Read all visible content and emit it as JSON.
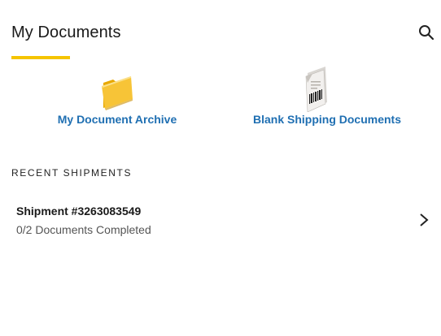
{
  "header": {
    "title": "My Documents",
    "search_icon": "search-icon",
    "accent_color": "#f5c400"
  },
  "tiles": [
    {
      "label": "My Document Archive",
      "icon": "folder-icon"
    },
    {
      "label": "Blank Shipping Documents",
      "icon": "barcode-document-icon"
    }
  ],
  "recent": {
    "section_label": "RECENT SHIPMENTS",
    "items": [
      {
        "title": "Shipment #3263083549",
        "status": "0/2 Documents Completed",
        "icon": "chevron-right-icon"
      }
    ]
  },
  "colors": {
    "link": "#1f6fb2",
    "text": "#1a1a1a",
    "muted": "#555555"
  }
}
